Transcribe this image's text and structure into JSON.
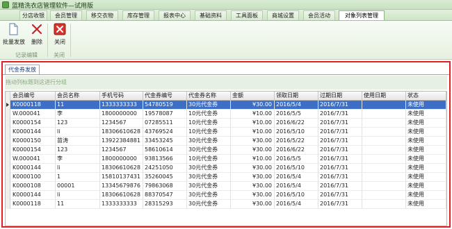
{
  "window": {
    "title": "蓝精洗衣店管理软件—试用版"
  },
  "tabs": [
    {
      "label": "分店收银"
    },
    {
      "label": "会员管理"
    },
    {
      "label": "移交衣物"
    },
    {
      "label": "库存管理"
    },
    {
      "label": "报表中心"
    },
    {
      "label": "基础资料"
    },
    {
      "label": "工具面板"
    },
    {
      "label": "商城设置"
    },
    {
      "label": "会员活动"
    },
    {
      "label": "对象列表管理"
    }
  ],
  "ribbon": {
    "batch_issue_label": "批量发放",
    "delete_label": "删除",
    "close_label": "关闭",
    "group_record": "记录编辑",
    "group_close": "关闭"
  },
  "panel": {
    "tab_label": "代金券发放",
    "group_hint": "拖动列标题到这进行分组"
  },
  "table": {
    "columns": [
      "会员编号",
      "会员名称",
      "手机号码",
      "代金券编号",
      "代金券名称",
      "金额",
      "领取日期",
      "过期日期",
      "使用日期",
      "状态"
    ],
    "rows": [
      [
        "K0000118",
        "11",
        "1333333333",
        "54780519",
        "30元代金券",
        "¥30.00",
        "2016/5/4",
        "2016/7/31",
        "",
        "未使用"
      ],
      [
        "W.000041",
        "李",
        "1800000000",
        "19578087",
        "10元代金券",
        "¥10.00",
        "2016/5/5",
        "2016/7/31",
        "",
        "未使用"
      ],
      [
        "K0000154",
        "123",
        "1234567",
        "07285511",
        "10元代金券",
        "¥10.00",
        "2016/6/22",
        "2016/7/31",
        "",
        "未使用"
      ],
      [
        "K0000144",
        "li",
        "18306610628",
        "43769524",
        "10元代金券",
        "¥10.00",
        "2016/5/10",
        "2016/7/31",
        "",
        "未使用"
      ],
      [
        "K0000150",
        "苗涛",
        "13922384881",
        "33453245",
        "30元代金券",
        "¥30.00",
        "2016/5/22",
        "2016/7/31",
        "",
        "未使用"
      ],
      [
        "K0000154",
        "123",
        "1234567",
        "58610614",
        "30元代金券",
        "¥30.00",
        "2016/6/22",
        "2016/7/31",
        "",
        "未使用"
      ],
      [
        "W.000041",
        "李",
        "1800000000",
        "93813566",
        "10元代金券",
        "¥10.00",
        "2016/5/5",
        "2016/7/31",
        "",
        "未使用"
      ],
      [
        "K0000144",
        "li",
        "18306610628",
        "24251050",
        "30元代金券",
        "¥30.00",
        "2016/5/10",
        "2016/7/31",
        "",
        "未使用"
      ],
      [
        "K0000100",
        "1",
        "15810137431",
        "35260045",
        "30元代金券",
        "¥30.00",
        "2016/5/4",
        "2016/7/31",
        "",
        "未使用"
      ],
      [
        "K0000108",
        "00001",
        "13345679876",
        "79863068",
        "30元代金券",
        "¥30.00",
        "2016/5/4",
        "2016/7/31",
        "",
        "未使用"
      ],
      [
        "K0000144",
        "li",
        "18306610628",
        "88370547",
        "30元代金券",
        "¥30.00",
        "2016/5/10",
        "2016/7/31",
        "",
        "未使用"
      ],
      [
        "K0000118",
        "11",
        "1333333333",
        "28315293",
        "30元代金券",
        "¥30.00",
        "2016/5/4",
        "2016/7/31",
        "",
        "未使用"
      ]
    ]
  }
}
